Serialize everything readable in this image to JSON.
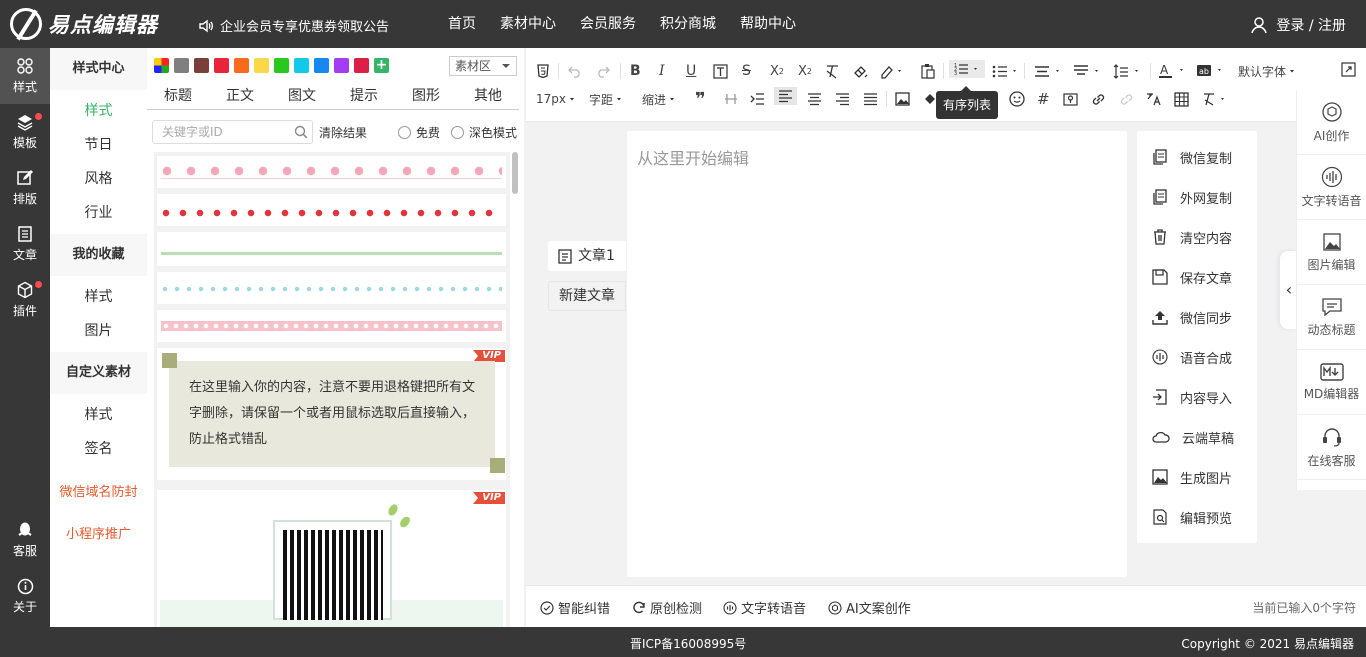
{
  "topbar": {
    "brand": "易点编辑器",
    "notice": "企业会员专享优惠券领取公告",
    "nav": [
      "首页",
      "素材中心",
      "会员服务",
      "积分商城",
      "帮助中心"
    ],
    "login": "登录 / 注册"
  },
  "left_nav": [
    {
      "label": "样式",
      "icon": "palette-icon",
      "active": true,
      "dot": false
    },
    {
      "label": "模板",
      "icon": "layers-icon",
      "active": false,
      "dot": true
    },
    {
      "label": "排版",
      "icon": "edit-icon",
      "active": false,
      "dot": false
    },
    {
      "label": "文章",
      "icon": "document-icon",
      "active": false,
      "dot": false
    },
    {
      "label": "插件",
      "icon": "cube-icon",
      "active": false,
      "dot": true
    }
  ],
  "left_nav_bottom": [
    {
      "label": "客服",
      "icon": "qq-penguin-icon"
    },
    {
      "label": "关于",
      "icon": "info-icon"
    }
  ],
  "categories": {
    "style_center": "样式中心",
    "style_items": [
      "样式",
      "节日",
      "风格",
      "行业"
    ],
    "favorites": "我的收藏",
    "favorite_items": [
      "样式",
      "图片"
    ],
    "custom": "自定义素材",
    "custom_items": [
      "样式",
      "签名"
    ],
    "promo1": "微信域名防封",
    "promo2": "小程序推广"
  },
  "materials": {
    "colors": [
      "#7f7f7f",
      "#7b3f3a",
      "#e8243c",
      "#f86a1e",
      "#f9d84a",
      "#28c81e",
      "#12c9e9",
      "#1788f2",
      "#a33cf3",
      "#dc1f46"
    ],
    "region_select": "素材区",
    "tabs": [
      "标题",
      "正文",
      "图文",
      "提示",
      "图形",
      "其他"
    ],
    "search_placeholder": "关键字或ID",
    "clear": "清除结果",
    "free": "免费",
    "dark_mode": "深色模式",
    "vip": "VIP",
    "sample_text": "在这里输入你的内容，注意不要用退格键把所有文字删除，请保留一个或者用鼠标选取后直接输入，防止格式错乱"
  },
  "toolbar": {
    "font": "默认字体",
    "font_size": "17px",
    "letter_spacing": "字距",
    "indent": "缩进",
    "tooltip": "有序列表"
  },
  "editor": {
    "placeholder": "从这里开始编辑",
    "article_tab": "文章1",
    "new_article": "新建文章"
  },
  "actions": [
    {
      "label": "微信复制",
      "icon": "copy-icon"
    },
    {
      "label": "外网复制",
      "icon": "copy-external-icon"
    },
    {
      "label": "清空内容",
      "icon": "trash-icon"
    },
    {
      "label": "保存文章",
      "icon": "save-icon"
    },
    {
      "label": "微信同步",
      "icon": "upload-icon"
    },
    {
      "label": "语音合成",
      "icon": "voice-icon"
    },
    {
      "label": "内容导入",
      "icon": "import-icon"
    },
    {
      "label": "云端草稿",
      "icon": "cloud-icon"
    },
    {
      "label": "生成图片",
      "icon": "image-icon"
    },
    {
      "label": "编辑预览",
      "icon": "preview-icon"
    }
  ],
  "right_sidebar": [
    {
      "label": "AI创作",
      "icon": "ai-icon"
    },
    {
      "label": "文字转语音",
      "icon": "soundwave-icon"
    },
    {
      "label": "图片编辑",
      "icon": "image-edit-icon"
    },
    {
      "label": "动态标题",
      "icon": "chat-icon"
    },
    {
      "label": "MD编辑器",
      "icon": "markdown-icon"
    },
    {
      "label": "在线客服",
      "icon": "headset-icon"
    }
  ],
  "statusbar": {
    "items": [
      "智能纠错",
      "原创检测",
      "文字转语音",
      "AI文案创作"
    ],
    "word_count": "当前已输入0个字符"
  },
  "footer": {
    "icp": "晋ICP备16008995号",
    "copyright": "Copyright © 2021 易点编辑器"
  }
}
